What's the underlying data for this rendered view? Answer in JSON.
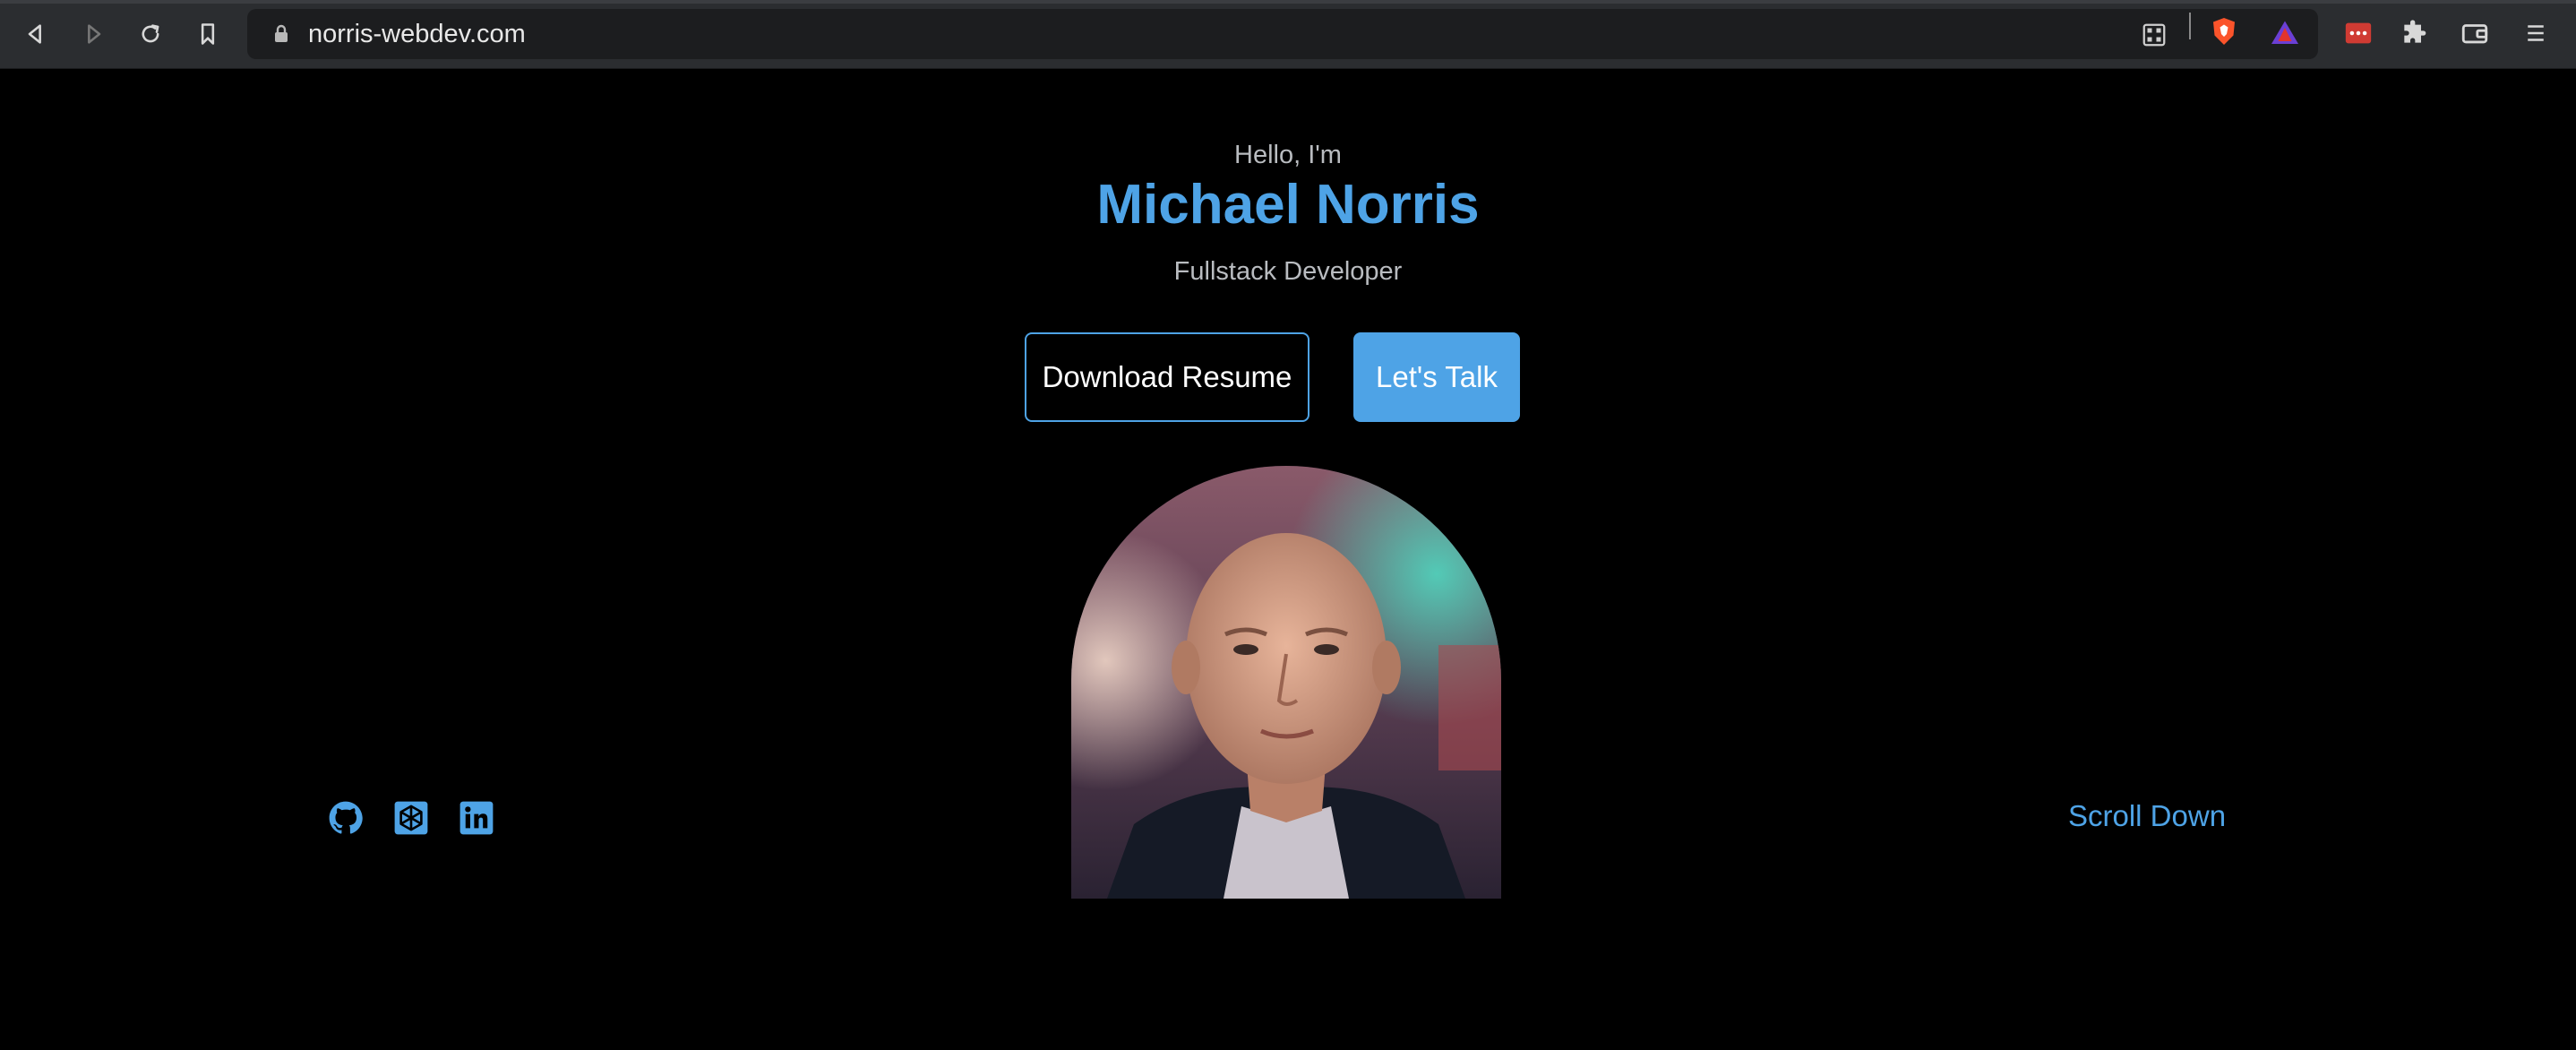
{
  "browser": {
    "url": "norris-webdev.com",
    "icons": {
      "back": "back-arrow-icon",
      "forward": "forward-arrow-icon",
      "reload": "reload-icon",
      "bookmark": "bookmark-icon",
      "lock": "lock-icon",
      "qr": "qr-code-icon",
      "brave": "brave-shield-icon",
      "rewards": "brave-rewards-icon",
      "password": "password-manager-icon",
      "extensions": "puzzle-extensions-icon",
      "wallet": "wallet-icon",
      "menu": "hamburger-menu-icon"
    }
  },
  "hero": {
    "greeting": "Hello, I'm",
    "name": "Michael Norris",
    "role": "Fullstack Developer",
    "download_label": "Download Resume",
    "talk_label": "Let's Talk",
    "scroll_label": "Scroll Down"
  },
  "socials": [
    {
      "icon": "github-icon"
    },
    {
      "icon": "codepen-hexagon-icon"
    },
    {
      "icon": "linkedin-icon"
    }
  ],
  "colors": {
    "accent": "#4ea3e6",
    "background": "#000000",
    "muted_text": "#b9bcc0",
    "chrome": "#2b2d30"
  }
}
